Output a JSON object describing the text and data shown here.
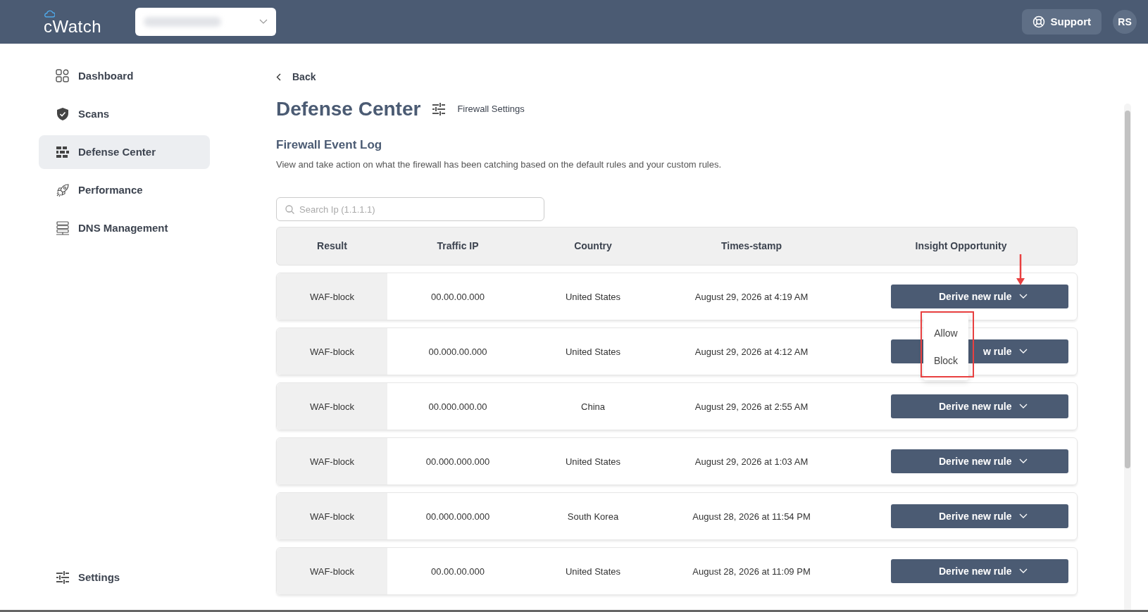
{
  "header": {
    "logo": "cWatch",
    "support": "Support",
    "avatar": "RS"
  },
  "sidebar": {
    "items": [
      {
        "label": "Dashboard",
        "selected": false
      },
      {
        "label": "Scans",
        "selected": false
      },
      {
        "label": "Defense Center",
        "selected": true
      },
      {
        "label": "Performance",
        "selected": false
      },
      {
        "label": "DNS Management",
        "selected": false
      }
    ],
    "footer_item": {
      "label": "Settings",
      "selected": false
    }
  },
  "back": "Back",
  "title": "Defense Center",
  "settings_link": "Firewall Settings",
  "section": {
    "title": "Firewall Event Log",
    "description": "View and take action on what the firewall has been catching based on the default rules and your custom rules."
  },
  "search": {
    "placeholder": "Search Ip (1.1.1.1)"
  },
  "table": {
    "columns": [
      "Result",
      "Traffic IP",
      "Country",
      "Times-stamp",
      "Insight Opportunity"
    ],
    "rows": [
      {
        "result": "WAF-block",
        "traffic_ip": "00.00.00.000",
        "country": "United States",
        "timestamp": "August 29, 2026 at 4:19 AM",
        "action": "Derive new rule",
        "menu_items": [
          "Allow",
          "Block"
        ]
      },
      {
        "result": "WAF-block",
        "traffic_ip": "00.000.00.000",
        "country": "United States",
        "timestamp": "August 29, 2026 at 4:12 AM",
        "action": "w rule"
      },
      {
        "result": "WAF-block",
        "traffic_ip": "00.000.000.00",
        "country": "China",
        "timestamp": "August 29, 2026 at 2:55 AM",
        "action": "Derive new rule"
      },
      {
        "result": "WAF-block",
        "traffic_ip": "00.000.000.000",
        "country": "United States",
        "timestamp": "August 29, 2026 at 1:03 AM",
        "action": "Derive new rule"
      },
      {
        "result": "WAF-block",
        "traffic_ip": "00.000.000.000",
        "country": "South Korea",
        "timestamp": "August 28, 2026 at 11:54 PM",
        "action": "Derive new rule"
      },
      {
        "result": "WAF-block",
        "traffic_ip": "00.00.00.000",
        "country": "United States",
        "timestamp": "August 28, 2026 at 11:09 PM",
        "action": "Derive new rule"
      }
    ]
  }
}
